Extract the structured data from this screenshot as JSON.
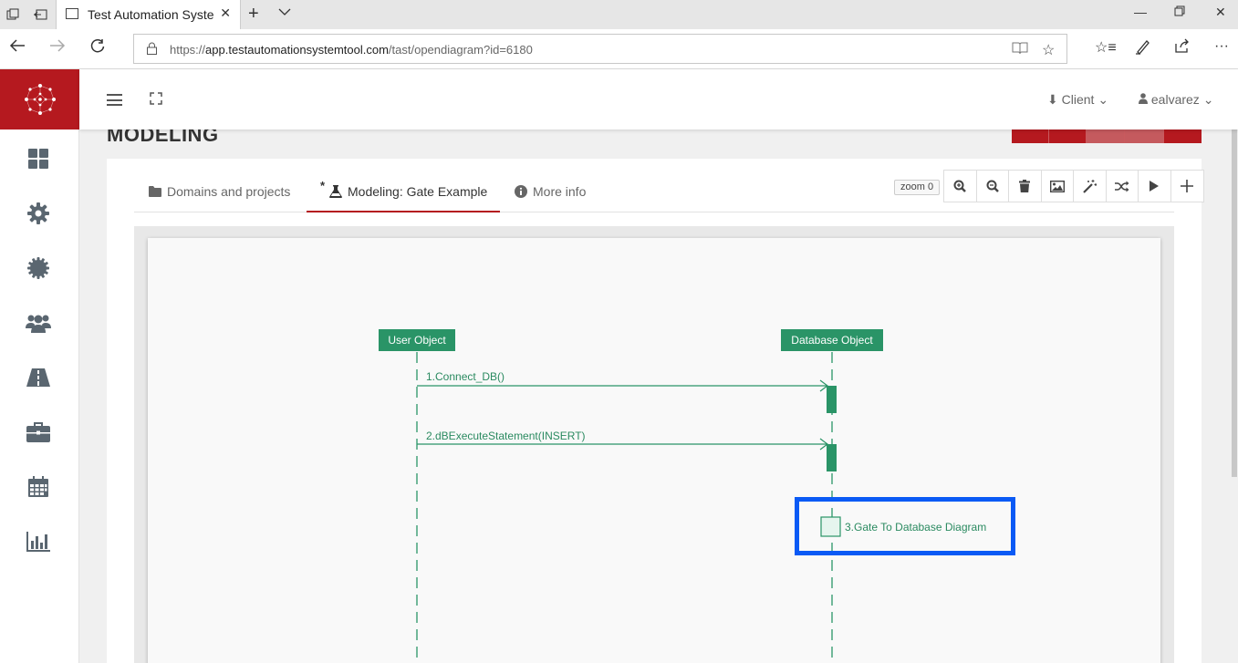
{
  "browser": {
    "tab_title": "Test Automation System",
    "url_prefix": "https://",
    "url_host": "app.testautomationsystemtool.com",
    "url_path": "/tast/opendiagram?id=6180"
  },
  "header": {
    "client_label": "Client",
    "user_label": "ealvarez"
  },
  "sidebar": {
    "items": [
      {
        "icon": "dashboard-icon"
      },
      {
        "icon": "gear-icon"
      },
      {
        "icon": "gear-alt-icon"
      },
      {
        "icon": "users-icon"
      },
      {
        "icon": "road-icon"
      },
      {
        "icon": "briefcase-icon"
      },
      {
        "icon": "calendar-icon"
      },
      {
        "icon": "bar-chart-icon"
      }
    ]
  },
  "page": {
    "title": "MODELING",
    "tabs": [
      {
        "label": "Domains and projects"
      },
      {
        "label": "Modeling: Gate Example",
        "modified_marker": "*"
      },
      {
        "label": "More info"
      }
    ],
    "zoom_label": "zoom 0"
  },
  "diagram": {
    "objects": [
      {
        "label": "User Object"
      },
      {
        "label": "Database Object"
      }
    ],
    "messages": [
      {
        "label": "1.Connect_DB()"
      },
      {
        "label": "2.dBExecuteStatement(INSERT)"
      }
    ],
    "gate": {
      "label": "3.Gate To Database Diagram"
    }
  },
  "colors": {
    "brand_red": "#b5191f",
    "diagram_green": "#2a9467",
    "highlight_blue": "#0a5af5"
  }
}
